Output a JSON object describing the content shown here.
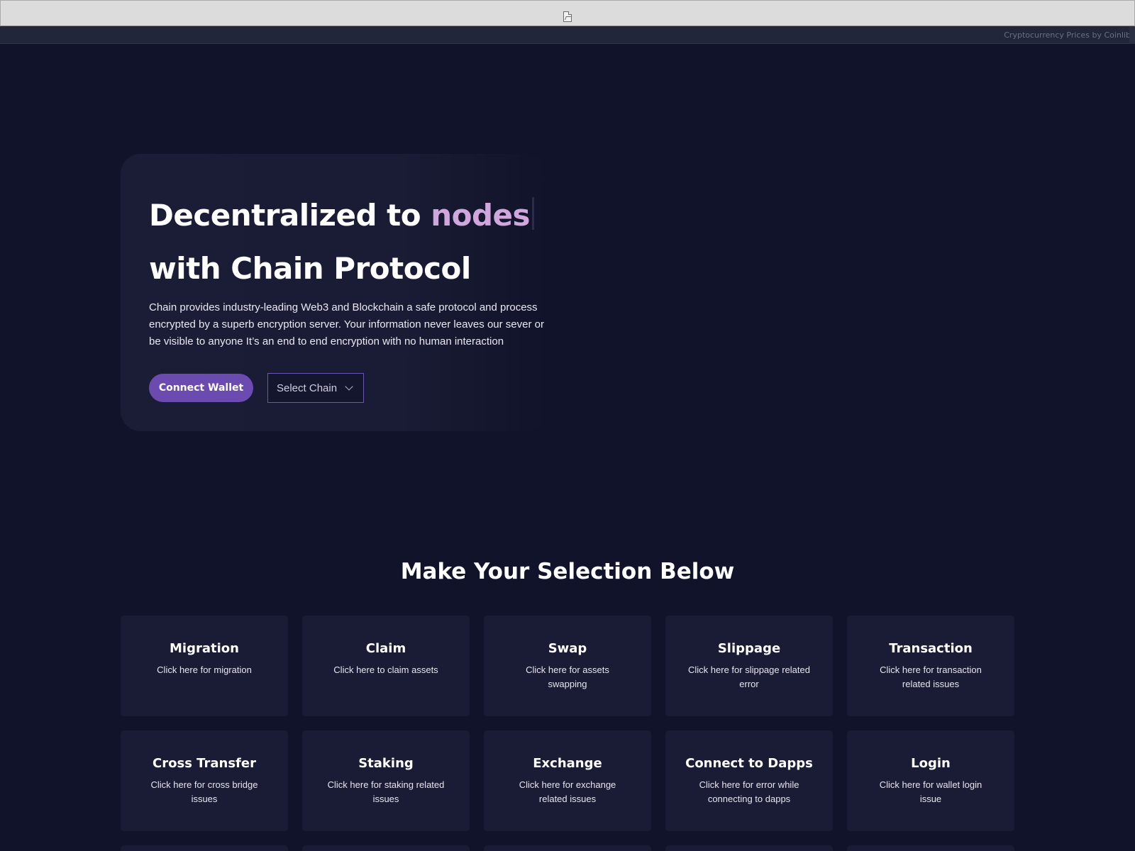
{
  "embed": {
    "broken_image_icon": "broken-image-icon",
    "ticker_credit": "Cryptocurrency Prices by Coinlib"
  },
  "hero": {
    "title_prefix": "Decentralized to ",
    "title_accent": "nodes",
    "title_line2": "with Chain Protocol",
    "description": "Chain provides industry-leading Web3 and Blockchain a safe protocol and process encrypted by a superb encryption server. Your information never leaves our sever or be visible to anyone It’s an end to end encryption with no human interaction",
    "connect_button": "Connect Wallet",
    "select_chain": "Select Chain",
    "accent_color": "#cfa7dc",
    "button_color": "#6c4bb0"
  },
  "section": {
    "title": "Make Your Selection Below"
  },
  "cards": [
    {
      "title": "Migration",
      "desc": "Click here for migration"
    },
    {
      "title": "Claim",
      "desc": "Click here to claim assets"
    },
    {
      "title": "Swap",
      "desc": "Click here for assets swapping"
    },
    {
      "title": "Slippage",
      "desc": "Click here for slippage related error"
    },
    {
      "title": "Transaction",
      "desc": "Click here for transaction related issues"
    },
    {
      "title": "Cross Transfer",
      "desc": "Click here for cross bridge issues"
    },
    {
      "title": "Staking",
      "desc": "Click here for staking related issues"
    },
    {
      "title": "Exchange",
      "desc": "Click here for exchange related issues"
    },
    {
      "title": "Connect to Dapps",
      "desc": "Click here for error while connecting to dapps"
    },
    {
      "title": "Login",
      "desc": "Click here for wallet login issue"
    }
  ]
}
